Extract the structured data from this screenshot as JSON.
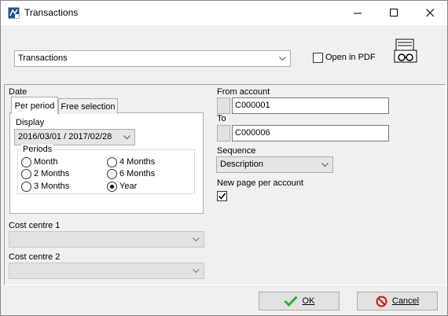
{
  "window": {
    "title": "Transactions"
  },
  "report_select": {
    "value": "Transactions"
  },
  "open_in_pdf": {
    "label": "Open in PDF",
    "checked": false
  },
  "date": {
    "label": "Date",
    "tabs": [
      "Per period",
      "Free selection"
    ],
    "display_label": "Display",
    "display_value": "2016/03/01 / 2017/02/28",
    "periods_label": "Periods",
    "periods": [
      {
        "label": "Month",
        "selected": false
      },
      {
        "label": "4 Months",
        "selected": false
      },
      {
        "label": "2 Months",
        "selected": false
      },
      {
        "label": "6 Months",
        "selected": false
      },
      {
        "label": "3 Months",
        "selected": false
      },
      {
        "label": "Year",
        "selected": true
      }
    ]
  },
  "cost_centre_1": {
    "label": "Cost centre 1",
    "value": ""
  },
  "cost_centre_2": {
    "label": "Cost centre 2",
    "value": ""
  },
  "from_account": {
    "label": "From account",
    "value": "C000001"
  },
  "to_account": {
    "label": "To",
    "value": "C000006"
  },
  "sequence": {
    "label": "Sequence",
    "value": "Description"
  },
  "new_page": {
    "label": "New page per account",
    "checked": true
  },
  "buttons": {
    "ok": "OK",
    "cancel": "Cancel"
  }
}
